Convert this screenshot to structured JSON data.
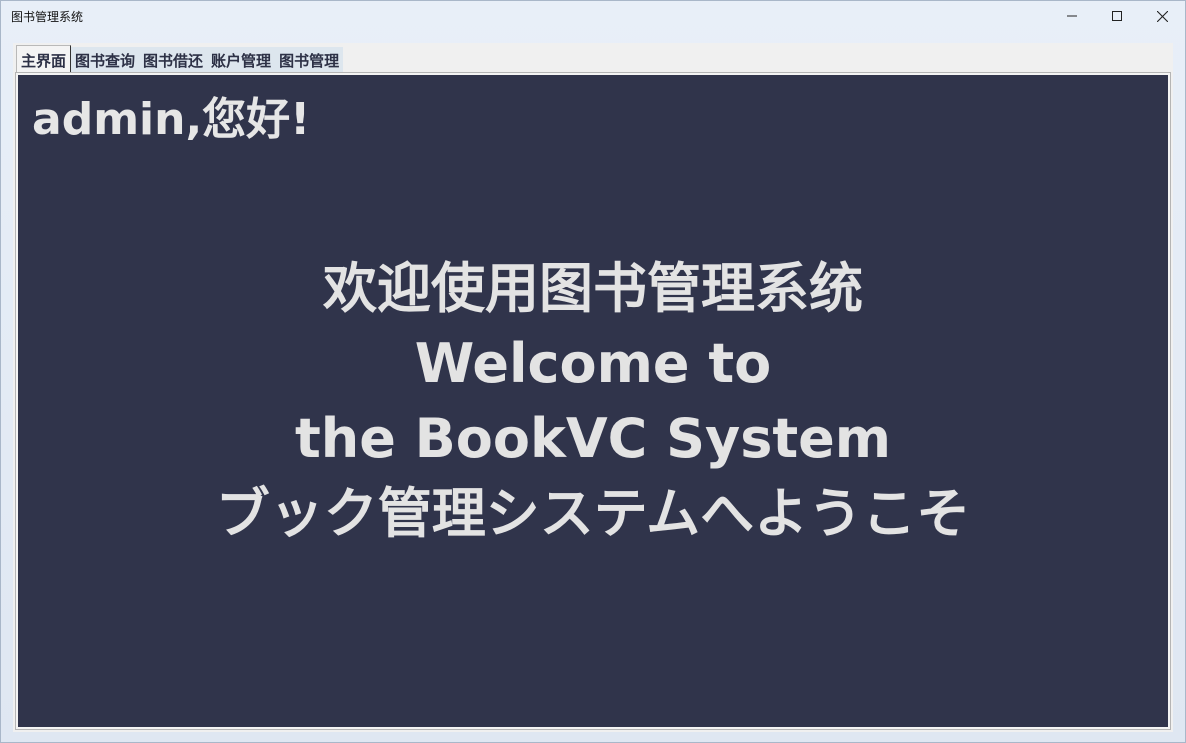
{
  "window": {
    "title": "图书管理系统"
  },
  "tabs": [
    {
      "label": "主界面",
      "active": true
    },
    {
      "label": "图书查询",
      "active": false
    },
    {
      "label": "图书借还",
      "active": false
    },
    {
      "label": "账户管理",
      "active": false
    },
    {
      "label": "图书管理",
      "active": false
    }
  ],
  "main": {
    "greeting": "admin,您好!",
    "welcome_lines": [
      "欢迎使用图书管理系统",
      "Welcome to",
      "the BookVC System",
      "ブック管理システムへようこそ"
    ]
  },
  "colors": {
    "panel_background": "#30344b",
    "text": "#e3e3e3",
    "tab_background": "#dde6ee"
  },
  "icons": [
    "minimize-icon",
    "maximize-icon",
    "close-icon"
  ]
}
